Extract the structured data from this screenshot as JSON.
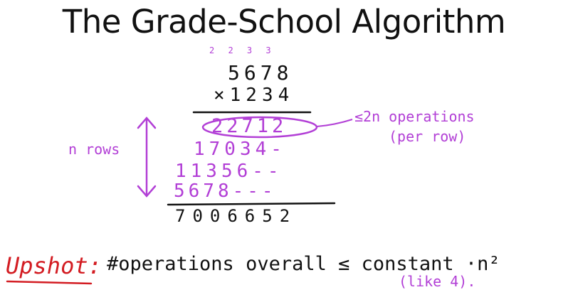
{
  "slide": {
    "title": "The Grade-School Algorithm"
  },
  "work": {
    "carries": "2 2 3 3",
    "multiplicand": "5678",
    "multiplier": "×1234",
    "partial_rows": [
      "22712",
      "17034-",
      "11356--",
      "5678---"
    ],
    "result": "7006652"
  },
  "annotations": {
    "rows_label": "n rows",
    "ops_line1": "≤2n operations",
    "ops_line2": "(per row)"
  },
  "upshot": {
    "label": "Upshot:",
    "text": "#operations overall ≤ constant ·n²",
    "paren": "(like 4)."
  },
  "colors": {
    "ink": "#111111",
    "purple": "#b23fd6",
    "red": "#d31c22"
  }
}
